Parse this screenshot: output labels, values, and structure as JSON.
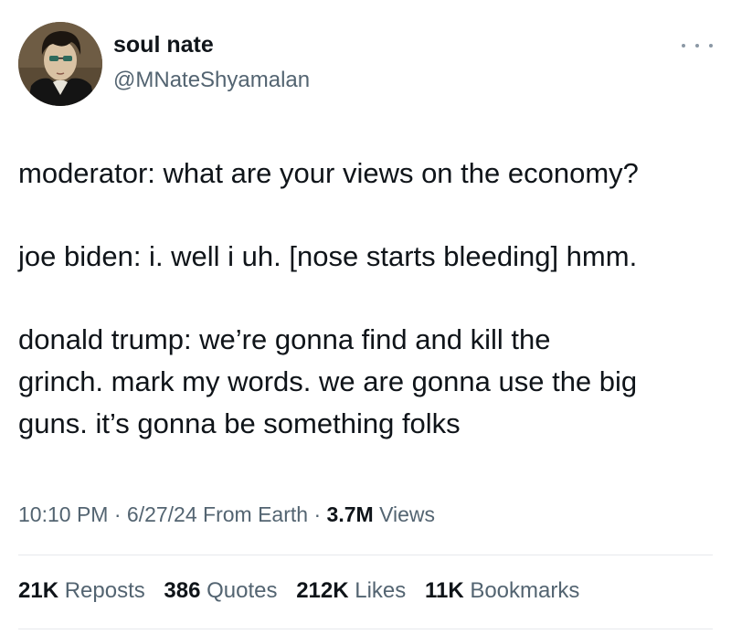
{
  "author": {
    "display_name": "soul nate",
    "handle": "@MNateShyamalan",
    "avatar": "avatar-portrait-illustration"
  },
  "more_icon": "more-dots-icon",
  "tweet": {
    "lines": [
      "moderator: what are your views on the economy?",
      "joe biden: i. well i uh. [nose starts bleeding] hmm.",
      "donald trump: we’re gonna find and kill the",
      "grinch. mark my words. we are gonna use the big",
      "guns. it’s gonna be something folks"
    ]
  },
  "meta": {
    "time": "10:10 PM",
    "date": "6/27/24",
    "source": "From Earth",
    "separator": "·",
    "views_count": "3.7M",
    "views_label": "Views"
  },
  "stats": {
    "reposts_count": "21K",
    "reposts_label": "Reposts",
    "quotes_count": "386",
    "quotes_label": "Quotes",
    "likes_count": "212K",
    "likes_label": "Likes",
    "bookmarks_count": "11K",
    "bookmarks_label": "Bookmarks"
  },
  "colors": {
    "text_primary": "#0f1419",
    "text_secondary": "#536471",
    "divider": "#e7e9ec"
  }
}
